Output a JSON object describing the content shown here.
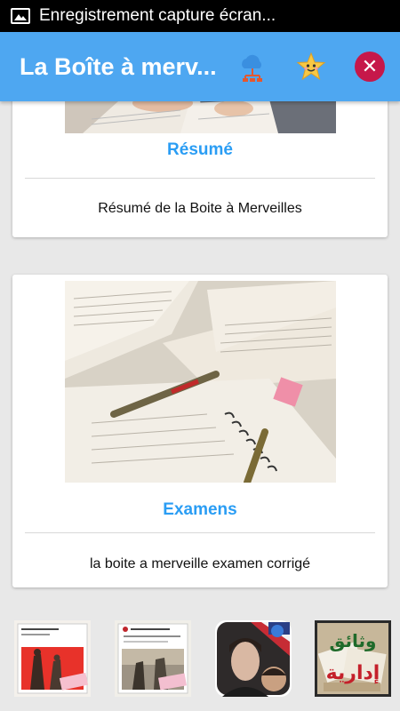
{
  "statusbar": {
    "text": "Enregistrement capture écran..."
  },
  "appbar": {
    "title": "La Boîte à merv..."
  },
  "cards": [
    {
      "heading": "Résumé",
      "description": "Résumé de la Boite à Merveilles"
    },
    {
      "heading": "Examens",
      "description": "la boite a merveille examen corrigé"
    }
  ],
  "thumbnails": [
    {
      "name": "book-cover-red"
    },
    {
      "name": "book-cover-victor-hugo"
    },
    {
      "name": "app-portrait"
    },
    {
      "name": "arabic-documents",
      "label": "وثائق إدارية"
    }
  ],
  "colors": {
    "appbar": "#4ea7f1",
    "accent": "#2a9df4",
    "close": "#c6184a"
  }
}
